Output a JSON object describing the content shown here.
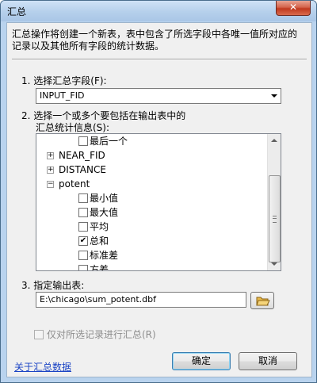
{
  "window": {
    "title": "汇总",
    "close_glyph": "✕"
  },
  "description": "汇总操作将创建一个新表，表中包含了所选字段中各唯一值所对应的记录以及其他所有字段的统计数据。",
  "step1": {
    "label": "1. 选择汇总字段(F):",
    "selected": "INPUT_FID"
  },
  "step2": {
    "label_line1": "2. 选择一个或多个要包括在输出表中的",
    "label_line2": "汇总统计信息(S):",
    "tree": {
      "top_item": {
        "label": "最后一个",
        "checked": false
      },
      "fields": [
        {
          "label": "NEAR_FID",
          "expanded": false,
          "expander": "+"
        },
        {
          "label": "DISTANCE",
          "expanded": false,
          "expander": "+"
        },
        {
          "label": "potent",
          "expanded": true,
          "expander": "−"
        }
      ],
      "stats": [
        {
          "label": "最小值",
          "checked": false,
          "mark": ""
        },
        {
          "label": "最大值",
          "checked": false,
          "mark": ""
        },
        {
          "label": "平均",
          "checked": false,
          "mark": ""
        },
        {
          "label": "总和",
          "checked": true,
          "mark": "✔"
        },
        {
          "label": "标准差",
          "checked": false,
          "mark": ""
        },
        {
          "label": "方差",
          "checked": false,
          "mark": ""
        }
      ]
    }
  },
  "step3": {
    "label": "3. 指定输出表:",
    "path": "E:\\chicago\\sum_potent.dbf"
  },
  "only_selected": {
    "label": "仅对所选记录进行汇总(R)",
    "enabled": false,
    "checked": false
  },
  "footer": {
    "help_link": "关于汇总数据",
    "ok": "确定",
    "cancel": "取消"
  },
  "colors": {
    "link": "#1a43c4",
    "folder": "#e8b94a"
  }
}
